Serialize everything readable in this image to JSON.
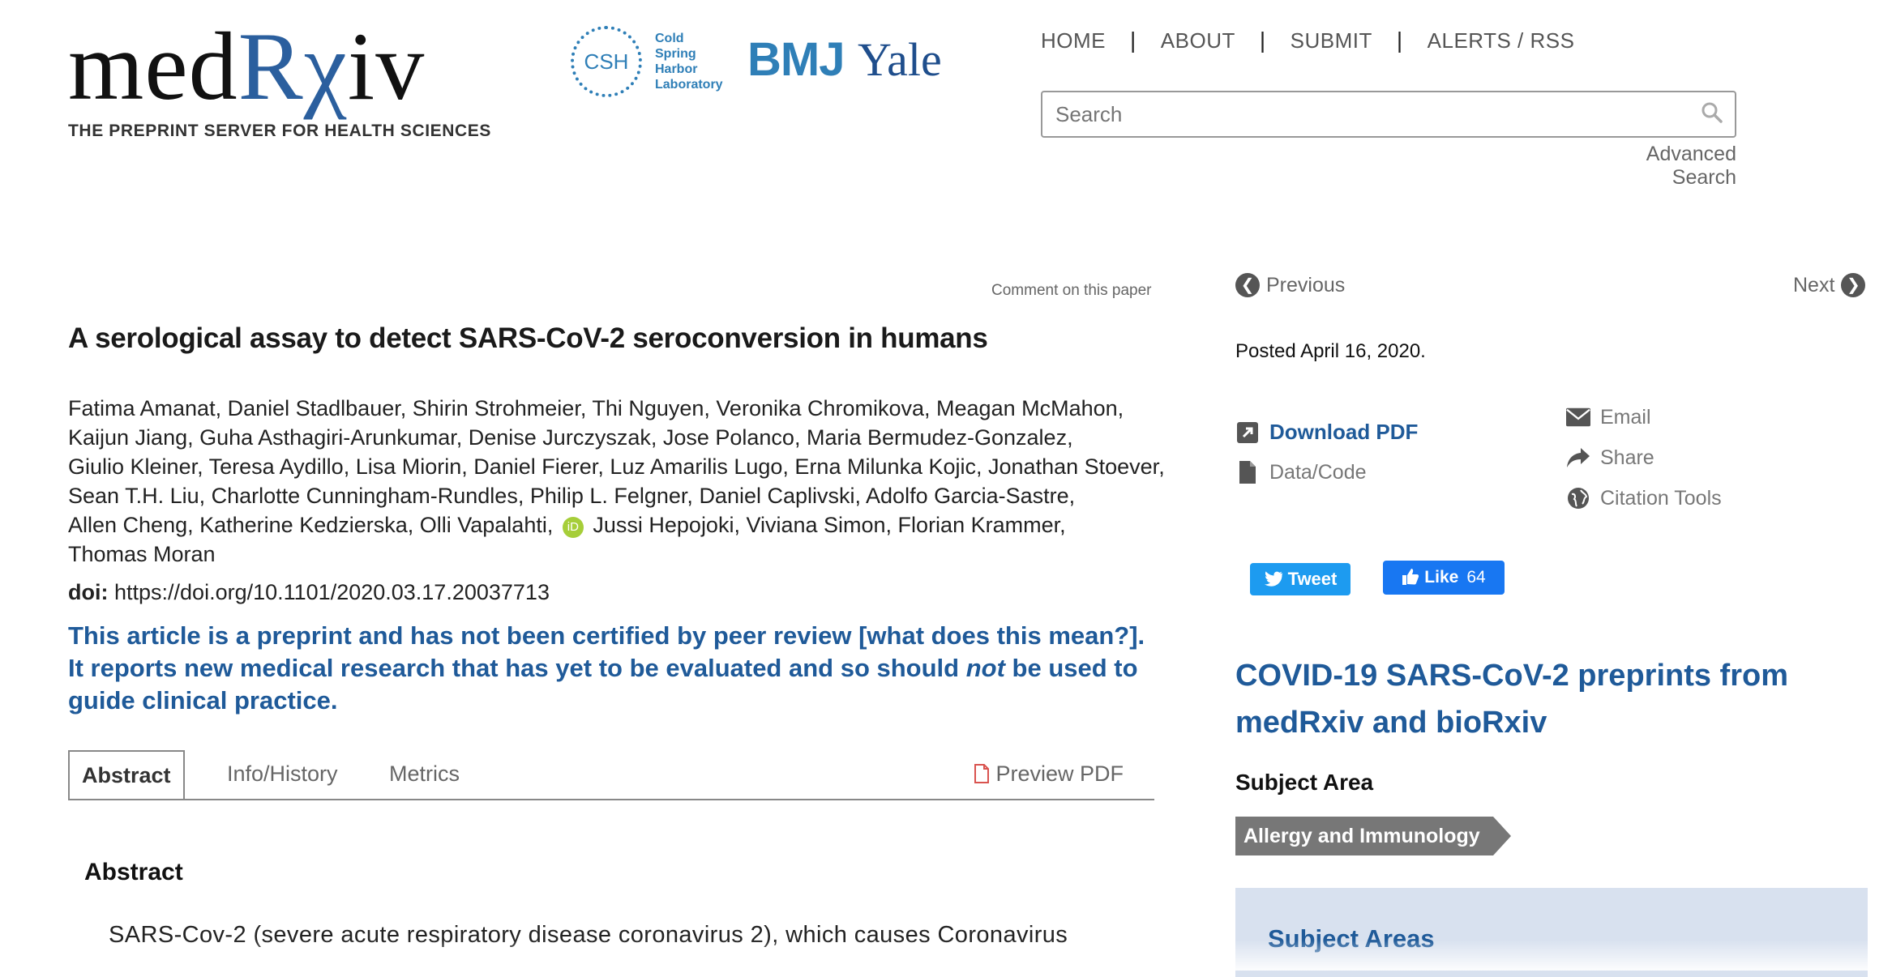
{
  "header": {
    "logo_pre": "med",
    "logo_rx": "Rχ",
    "logo_post": "iv",
    "tagline": "THE PREPRINT SERVER FOR HEALTH SCIENCES",
    "csh_mark": "CSH",
    "csh_lines": [
      "Cold",
      "Spring",
      "Harbor",
      "Laboratory"
    ],
    "bmj": "BMJ",
    "yale": "Yale",
    "nav": [
      "HOME",
      "ABOUT",
      "SUBMIT",
      "ALERTS / RSS"
    ],
    "search_placeholder": "Search",
    "advanced_search": "Advanced Search"
  },
  "article": {
    "comment_link": "Comment on this paper",
    "title": "A serological assay to detect SARS-CoV-2 seroconversion in humans",
    "author_lines": [
      "Fatima Amanat, Daniel Stadlbauer, Shirin Strohmeier, Thi Nguyen, Veronika Chromikova, Meagan McMahon,",
      "Kaijun Jiang, Guha Asthagiri-Arunkumar, Denise Jurczyszak, Jose Polanco, Maria Bermudez-Gonzalez,",
      "Giulio Kleiner, Teresa Aydillo, Lisa Miorin, Daniel Fierer, Luz Amarilis Lugo, Erna Milunka Kojic, Jonathan Stoever,",
      "Sean T.H. Liu, Charlotte Cunningham-Rundles, Philip L. Felgner, Daniel Caplivski, Adolfo Garcia-Sastre,",
      "Allen Cheng, Katherine Kedzierska, Olli Vapalahti,",
      "Jussi Hepojoki, Viviana Simon, Florian Krammer,",
      "Thomas Moran"
    ],
    "doi_label": "doi:",
    "doi_value": "https://doi.org/10.1101/2020.03.17.20037713",
    "notice_part1": "This article is a preprint and has not been certified by peer review [what does this mean?]. It reports new medical research that has yet to be evaluated and so should ",
    "notice_not": "not",
    "notice_part2": " be used to guide clinical practice.",
    "tabs": [
      "Abstract",
      "Info/History",
      "Metrics"
    ],
    "preview_pdf": "Preview PDF",
    "abstract_heading": "Abstract",
    "abstract_text": "SARS-Cov-2 (severe acute respiratory disease coronavirus 2), which causes Coronavirus"
  },
  "sidebar": {
    "previous": "Previous",
    "next": "Next",
    "posted": "Posted April 16, 2020.",
    "download_pdf": "Download PDF",
    "data_code": "Data/Code",
    "email": "Email",
    "share": "Share",
    "citation_tools": "Citation Tools",
    "tweet": "Tweet",
    "like": "Like",
    "like_count": "64",
    "covid_title": "COVID-19 SARS-CoV-2 preprints from medRxiv and bioRxiv",
    "subject_area_label": "Subject Area",
    "subject_tag": "Allergy and Immunology",
    "subject_areas_title": "Subject Areas"
  },
  "colors": {
    "brand_blue": "#2b5f9e",
    "link_blue": "#1f5a99",
    "tweet": "#1d9bf0",
    "facebook": "#1877f2",
    "orcid": "#a6ce39"
  }
}
